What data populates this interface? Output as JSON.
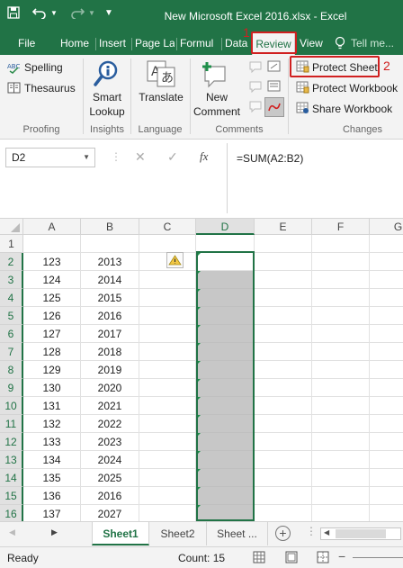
{
  "window": {
    "title": "New Microsoft Excel 2016.xlsx - Excel"
  },
  "tabs": [
    {
      "label": "File"
    },
    {
      "label": "Home"
    },
    {
      "label": "Insert"
    },
    {
      "label": "Page La"
    },
    {
      "label": "Formul"
    },
    {
      "label": "Data"
    },
    {
      "label": "Review"
    },
    {
      "label": "View"
    },
    {
      "label": "Tell me..."
    }
  ],
  "annotations": {
    "step1": "1",
    "step2": "2",
    "highlight_color": "#d02020"
  },
  "ribbon": {
    "spelling": "Spelling",
    "thesaurus": "Thesaurus",
    "proofing_label": "Proofing",
    "smart_lookup_line1": "Smart",
    "smart_lookup_line2": "Lookup",
    "insights_label": "Insights",
    "translate": "Translate",
    "language_label": "Language",
    "new_comment_line1": "New",
    "new_comment_line2": "Comment",
    "comments_label": "Comments",
    "protect_sheet": "Protect Sheet",
    "protect_workbook": "Protect Workbook",
    "share_workbook": "Share Workbook",
    "changes_label": "Changes"
  },
  "formula_bar": {
    "name_box": "D2",
    "formula": "=SUM(A2:B2)"
  },
  "grid": {
    "columns": [
      "A",
      "B",
      "C",
      "D",
      "E",
      "F",
      "G"
    ],
    "rows": [
      "1",
      "2",
      "3",
      "4",
      "5",
      "6",
      "7",
      "8",
      "9",
      "10",
      "11",
      "12",
      "13",
      "14",
      "15",
      "16"
    ],
    "col_a": [
      "",
      "123",
      "124",
      "125",
      "126",
      "127",
      "128",
      "129",
      "130",
      "131",
      "132",
      "133",
      "134",
      "135",
      "136",
      "137"
    ],
    "col_b": [
      "",
      "2013",
      "2014",
      "2015",
      "2016",
      "2017",
      "2018",
      "2019",
      "2020",
      "2021",
      "2022",
      "2023",
      "2024",
      "2025",
      "2016",
      "2027"
    ]
  },
  "sheets": [
    "Sheet1",
    "Sheet2",
    "Sheet ..."
  ],
  "status": {
    "ready": "Ready",
    "count": "Count: 15"
  },
  "colors": {
    "excel_green": "#217346",
    "selection_gray": "#c7c7c7"
  }
}
